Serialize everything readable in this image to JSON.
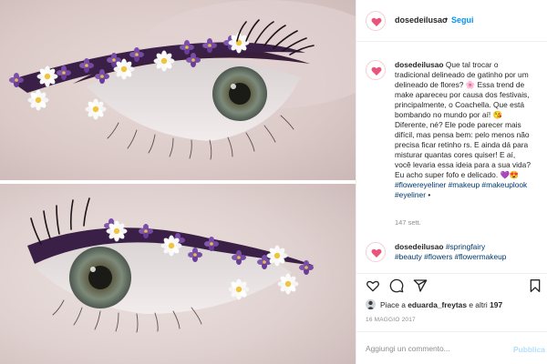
{
  "post": {
    "username": "dosedeilusao",
    "follow_label": "Segui",
    "separator": "•"
  },
  "caption": {
    "username": "dosedeilusao",
    "lines": [
      "Que tal trocar o",
      "tradicional delineado de gatinho por um",
      "delineado de flores? 🌸 Essa trend de",
      "make apareceu por causa dos festivais,",
      "principalmente, o Coachella. Que está",
      "bombando no mundo por aí! 😘",
      "Diferente, né? Ele pode parecer mais",
      "difícil, mas pensa bem: pelo menos não",
      "precisa ficar retinho rs. E ainda dá para",
      "misturar quantas cores quiser! E aí,",
      "você levaria essa ideia para a sua vida?",
      "Eu acho super fofo e delicado. 💜😍"
    ],
    "hashtags_line1": "#flowereyeliner #makeup #makeuplook",
    "hashtags_line2": "#eyeliner",
    "hashtags_line2_suffix": "•",
    "time": "147 sett."
  },
  "comment": {
    "username": "dosedeilusao",
    "tag_first": "#springfairy",
    "tags_line2": "#beauty #flowers #flowermakeup"
  },
  "likes": {
    "prefix": "Piace a",
    "user": "eduarda_freytas",
    "middle": "e altri",
    "count": "197"
  },
  "date": "16 MAGGIO 2017",
  "add_comment": {
    "placeholder": "Aggiungi un commento...",
    "publish_label": "Pubblica"
  },
  "icons": {
    "like": "heart-icon",
    "comment": "comment-icon",
    "share": "share-icon",
    "save": "bookmark-icon"
  },
  "colors": {
    "follow_blue": "#0095f6",
    "hashtag_blue": "#00376b",
    "muted_gray": "#8e8e8e",
    "publish_disabled": "#b2dffc",
    "avatar_pink": "#e8547a"
  }
}
